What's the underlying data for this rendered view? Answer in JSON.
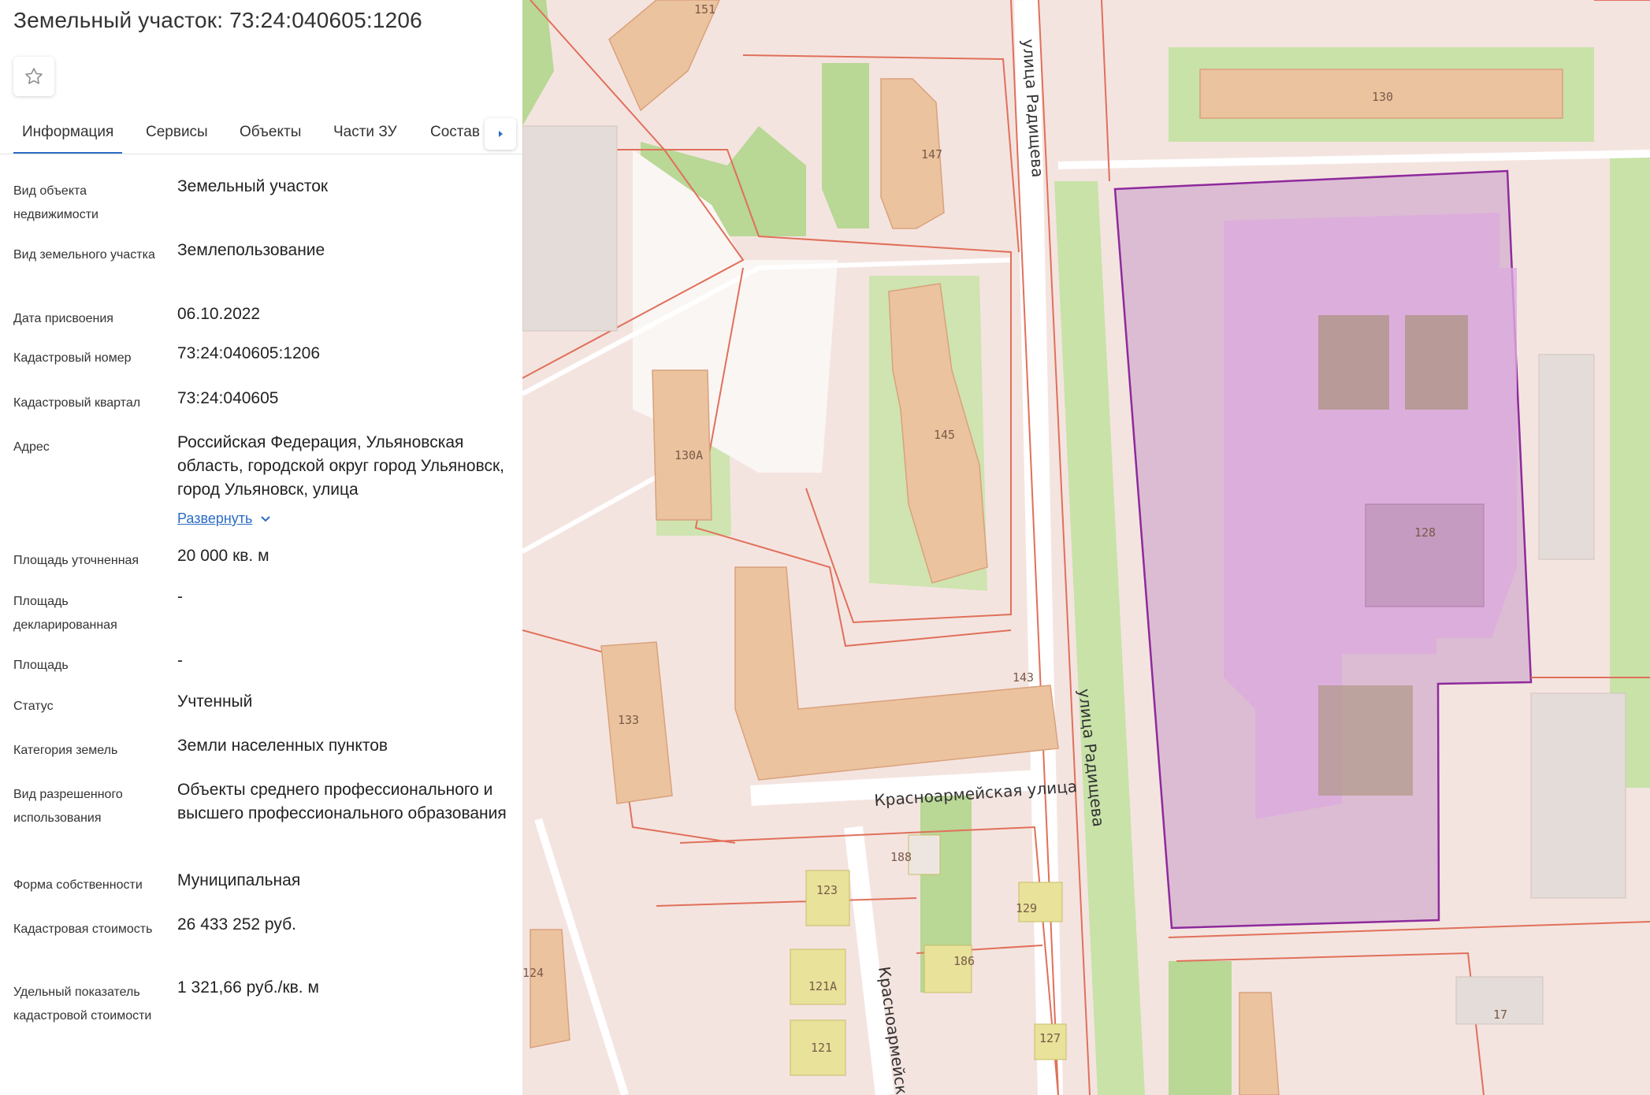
{
  "panel": {
    "title": "Земельный участок: 73:24:040605:1206",
    "favorite_icon": "star-outline-icon",
    "tabs": [
      {
        "label": "Информация",
        "active": true
      },
      {
        "label": "Сервисы",
        "active": false
      },
      {
        "label": "Объекты",
        "active": false
      },
      {
        "label": "Части ЗУ",
        "active": false
      },
      {
        "label": "Состав",
        "active": false
      }
    ],
    "tabs_scroll_icon": "caret-right-icon",
    "fields": [
      {
        "label": "Вид объекта недвижимости",
        "value": "Земельный участок"
      },
      {
        "label": "Вид земельного участка",
        "value": "Землепользование"
      },
      {
        "label": "Дата присвоения",
        "value": "06.10.2022"
      },
      {
        "label": "Кадастровый номер",
        "value": "73:24:040605:1206"
      },
      {
        "label": "Кадастровый квартал",
        "value": "73:24:040605"
      },
      {
        "label": "Адрес",
        "value": "Российская Федерация, Ульяновская область, городской округ город Ульяновск, город Ульяновск, улица"
      },
      {
        "label": "Площадь уточненная",
        "value": "20 000 кв. м"
      },
      {
        "label": "Площадь декларированная",
        "value": "-"
      },
      {
        "label": "Площадь",
        "value": "-"
      },
      {
        "label": "Статус",
        "value": "Учтенный"
      },
      {
        "label": "Категория земель",
        "value": "Земли населенных пунктов"
      },
      {
        "label": "Вид разрешенного использования",
        "value": "Объекты среднего профессионального и высшего профессионального образования"
      },
      {
        "label": "Форма собственности",
        "value": "Муниципальная"
      },
      {
        "label": "Кадастровая стоимость",
        "value": "26 433 252 руб."
      },
      {
        "label": "Удельный показатель кадастровой стоимости",
        "value": "1 321,66 руб./кв. м"
      }
    ],
    "expand_label": "Развернуть",
    "expand_icon": "chevron-down-icon",
    "accent_color": "#2b6cc4"
  },
  "map": {
    "streets": {
      "radishcheva_top": "улица Радищева",
      "radishcheva_mid": "улица Радищева",
      "krasnoarmeyskaya": "Красноармейская улица",
      "krasnoarmeysk_vertical": "Красноармейск"
    },
    "buildings": [
      "151",
      "130",
      "147",
      "130А",
      "145",
      "128",
      "143",
      "133",
      "188",
      "123",
      "129",
      "186",
      "121А",
      "121",
      "127",
      "124",
      "17"
    ],
    "selected_parcel_color": "#8e2a9c",
    "parcel_border_color": "#e0705a"
  }
}
